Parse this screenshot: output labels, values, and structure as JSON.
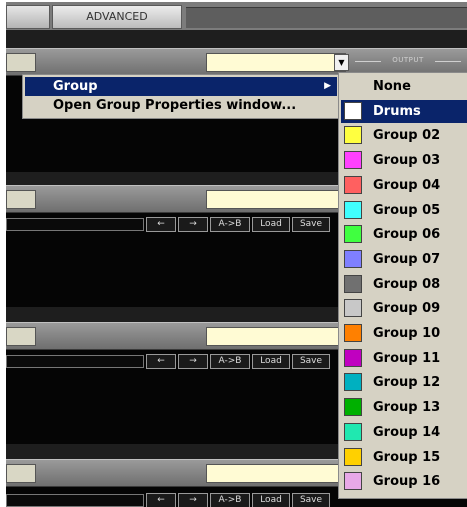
{
  "tabs": {
    "advanced": "ADVANCED"
  },
  "output_label": "OUTPUT",
  "strip_buttons": {
    "prev": "←",
    "next": "→",
    "ab": "A->B",
    "load": "Load",
    "save": "Save"
  },
  "context_menu": {
    "items": [
      {
        "label": "Group",
        "submenu_arrow": "▶"
      },
      {
        "label": "Open Group Properties window..."
      }
    ]
  },
  "group_submenu": {
    "items": [
      {
        "label": "None",
        "color": ""
      },
      {
        "label": "Drums",
        "color": "#ffffff"
      },
      {
        "label": "Group 02",
        "color": "#ffff40"
      },
      {
        "label": "Group 03",
        "color": "#ff40ff"
      },
      {
        "label": "Group 04",
        "color": "#ff6060"
      },
      {
        "label": "Group 05",
        "color": "#40ffff"
      },
      {
        "label": "Group 06",
        "color": "#40ff40"
      },
      {
        "label": "Group 07",
        "color": "#7f7fff"
      },
      {
        "label": "Group 08",
        "color": "#707070"
      },
      {
        "label": "Group 09",
        "color": "#c8c8c8"
      },
      {
        "label": "Group 10",
        "color": "#ff8000"
      },
      {
        "label": "Group 11",
        "color": "#c000c0"
      },
      {
        "label": "Group 12",
        "color": "#00b0c0"
      },
      {
        "label": "Group 13",
        "color": "#00b000"
      },
      {
        "label": "Group 14",
        "color": "#20e8b0"
      },
      {
        "label": "Group 15",
        "color": "#ffd000"
      },
      {
        "label": "Group 16",
        "color": "#e8a8e8"
      }
    ],
    "selected_index": 1
  }
}
